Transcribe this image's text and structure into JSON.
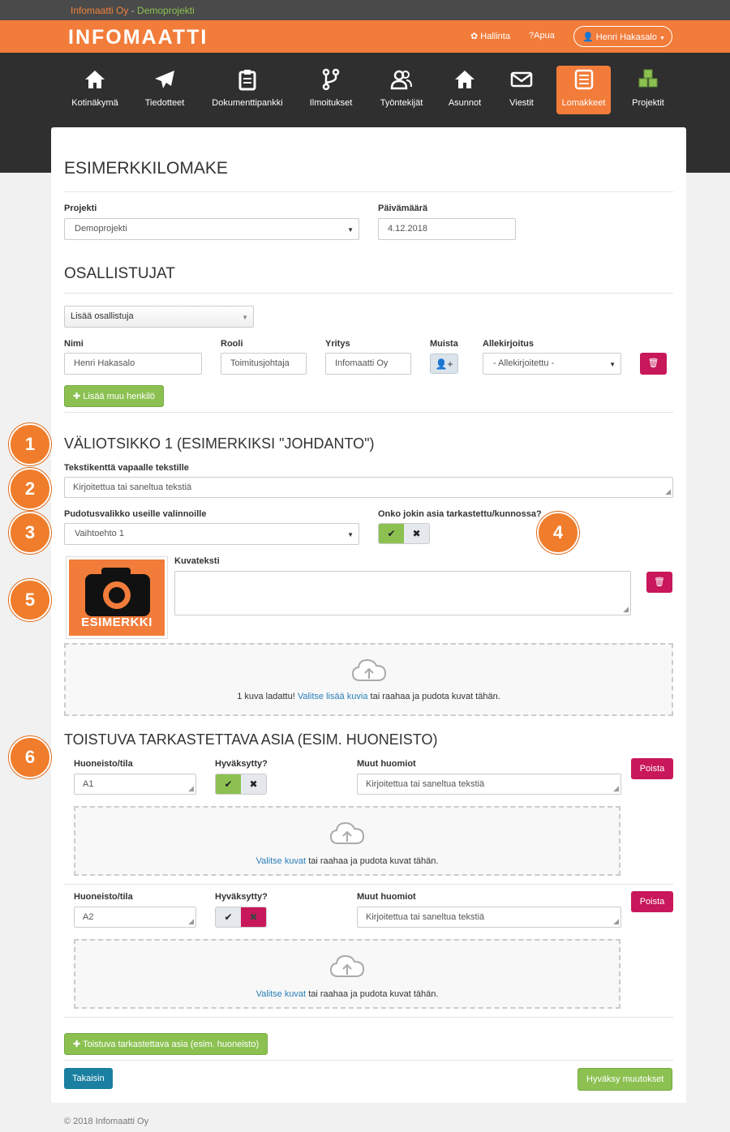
{
  "topbar": {
    "org": "Infomaatti Oy",
    "sep": " - ",
    "project": "Demoprojekti"
  },
  "header": {
    "logo": "INFOMAATTI",
    "admin": "Hallinta",
    "help": "Apua",
    "user": "Henri Hakasalo"
  },
  "nav": [
    {
      "label": "Kotinäkymä",
      "icon": "home-icon"
    },
    {
      "label": "Tiedotteet",
      "icon": "paper-plane-icon"
    },
    {
      "label": "Dokumenttipankki",
      "icon": "clipboard-icon"
    },
    {
      "label": "Ilmoitukset",
      "icon": "branch-icon"
    },
    {
      "label": "Työntekijät",
      "icon": "users-icon"
    },
    {
      "label": "Asunnot",
      "icon": "house-icon"
    },
    {
      "label": "Viestit",
      "icon": "envelope-icon"
    },
    {
      "label": "Lomakkeet",
      "icon": "form-icon",
      "active": true
    },
    {
      "label": "Projektit",
      "icon": "cubes-icon"
    }
  ],
  "form": {
    "title": "ESIMERKKILOMAKE",
    "project_label": "Projekti",
    "project_value": "Demoprojekti",
    "date_label": "Päivämäärä",
    "date_value": "4.12.2018"
  },
  "participants": {
    "title": "OSALLISTUJAT",
    "add_select": "Lisää osallistuja",
    "col_name": "Nimi",
    "col_role": "Rooli",
    "col_company": "Yritys",
    "col_remember": "Muista",
    "col_signature": "Allekirjoitus",
    "row": {
      "name": "Henri Hakasalo",
      "role": "Toimitusjohtaja",
      "company": "Infomaatti Oy",
      "signature": "- Allekirjoitettu -"
    },
    "add_other": "Lisää muu henkilö"
  },
  "section1": {
    "title": "VÄLIOTSIKKO 1 (ESIMERKIKSI \"JOHDANTO\")",
    "text_label": "Tekstikenttä vapaalle tekstille",
    "text_value": "Kirjoitettua tai saneltua tekstiä",
    "dropdown_label": "Pudotusvalikko useille valinnoille",
    "dropdown_value": "Vaihtoehto 1",
    "check_label": "Onko jokin asia tarkastettu/kunnossa?",
    "caption_label": "Kuvateksti",
    "image_caption": "ESIMERKKI",
    "upload_prefix": "1 kuva ladattu!",
    "upload_link": "Valitse lisää kuvia",
    "upload_suffix": "tai raahaa ja pudota kuvat tähän."
  },
  "section2": {
    "title": "TOISTUVA TARKASTETTAVA ASIA (ESIM. HUONEISTO)",
    "room_label": "Huoneisto/tila",
    "approved_label": "Hyväksytty?",
    "notes_label": "Muut huomiot",
    "delete_label": "Poista",
    "upload_link": "Valitse kuvat",
    "upload_suffix": "tai raahaa ja pudota kuvat tähän.",
    "items": [
      {
        "room": "A1",
        "notes": "Kirjoitettua tai saneltua tekstiä",
        "approved": true
      },
      {
        "room": "A2",
        "notes": "Kirjoitettua tai saneltua tekstiä",
        "approved": false
      }
    ],
    "add_label": "Toistuva tarkastettava asia (esim. huoneisto)"
  },
  "actions": {
    "back": "Takaisin",
    "accept": "Hyväksy muutokset"
  },
  "badges": [
    "1",
    "2",
    "3",
    "4",
    "5",
    "6"
  ],
  "footer": "© 2018 Infomaatti Oy",
  "colors": {
    "brand": "#f27c3a",
    "green": "#8cc152",
    "red": "#c8175a",
    "blue": "#1a7fa0"
  }
}
